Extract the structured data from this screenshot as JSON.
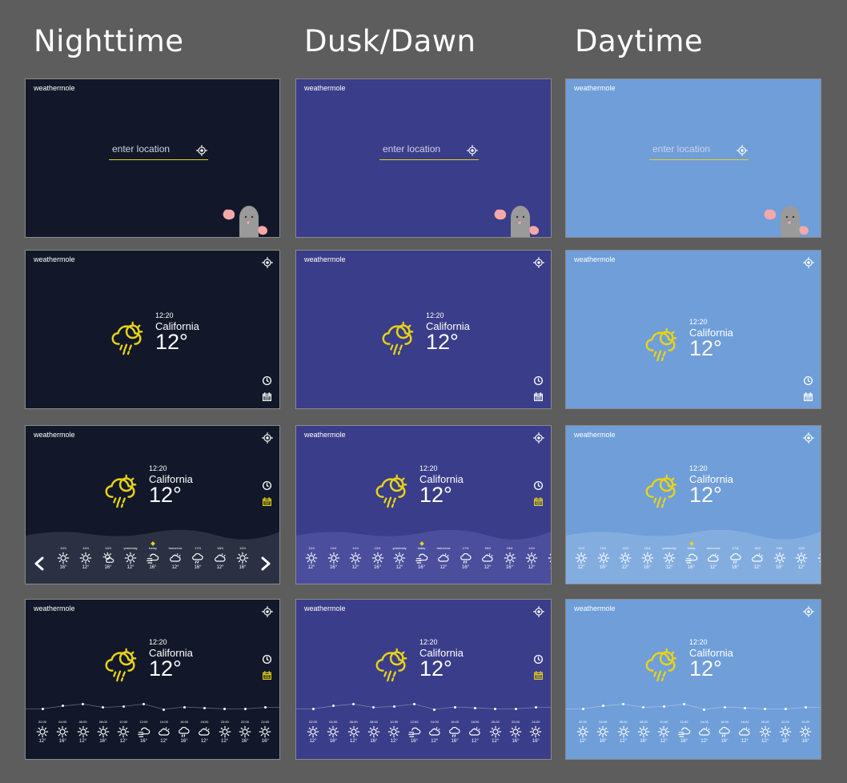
{
  "columns": [
    {
      "heading": "Nighttime",
      "theme": "night"
    },
    {
      "heading": "Dusk/Dawn",
      "theme": "dusk"
    },
    {
      "heading": "Daytime",
      "theme": "day"
    }
  ],
  "colors": {
    "background": "#5d5d5d",
    "night": "#121829",
    "dusk": "#3a3d89",
    "day": "#6f9ed9",
    "accent": "#e8d317",
    "night_hills": "#2b3143",
    "dusk_hills": "#4a4e9c",
    "day_hills": "#84addf",
    "mole_body": "#9a9a9a",
    "mole_paw": "#f4a9a8"
  },
  "app": {
    "brand": "weathermole",
    "search_placeholder": "enter location",
    "time": "12:20",
    "place": "California",
    "temperature": "12°"
  },
  "icons": {
    "location": "gps-target-icon",
    "pin": "location-pin-icon",
    "clock": "clock-icon",
    "calendar": "calendar-icon",
    "current_weather": "cloud-sun-rain-icon",
    "prev": "chevron-left-icon",
    "next": "chevron-right-icon"
  },
  "daily_forecast": [
    {
      "label": "12/4",
      "icon": "sun-icon",
      "temp": "16°"
    },
    {
      "label": "12/4",
      "icon": "sun-icon",
      "temp": "12°"
    },
    {
      "label": "12/4",
      "icon": "sun-cloud-icon",
      "temp": "16°"
    },
    {
      "label": "yesterday",
      "icon": "sun-icon",
      "temp": "12°"
    },
    {
      "label": "today",
      "icon": "wind-cloud-icon",
      "temp": "16°"
    },
    {
      "label": "tomorrow",
      "icon": "cloud-sun-icon",
      "temp": "12°"
    },
    {
      "label": "17/4",
      "icon": "cloud-rain-icon",
      "temp": "16°"
    },
    {
      "label": "18/4",
      "icon": "cloud-sun-icon",
      "temp": "12°"
    },
    {
      "label": "12/4",
      "icon": "sun-icon",
      "temp": "16°"
    }
  ],
  "daily_forecast_12": [
    {
      "label": "12/4",
      "icon": "sun-icon",
      "temp": "12°"
    },
    {
      "label": "12/4",
      "icon": "sun-icon",
      "temp": "16°"
    },
    {
      "label": "12/4",
      "icon": "sun-icon",
      "temp": "12°"
    },
    {
      "label": "12/4",
      "icon": "sun-icon",
      "temp": "16°"
    },
    {
      "label": "yesterday",
      "icon": "sun-icon",
      "temp": "12°"
    },
    {
      "label": "today",
      "icon": "wind-cloud-icon",
      "temp": "16°"
    },
    {
      "label": "tomorrow",
      "icon": "cloud-sun-icon",
      "temp": "12°"
    },
    {
      "label": "17/4",
      "icon": "cloud-rain-icon",
      "temp": "16°"
    },
    {
      "label": "18/4",
      "icon": "cloud-sun-icon",
      "temp": "12°"
    },
    {
      "label": "19/4",
      "icon": "sun-icon",
      "temp": "16°"
    },
    {
      "label": "12/4",
      "icon": "sun-icon",
      "temp": "12°"
    },
    {
      "label": "12/4",
      "icon": "sun-icon",
      "temp": "16°"
    }
  ],
  "hourly_forecast": [
    {
      "label": "02:00",
      "icon": "sun-icon",
      "temp": "12°",
      "level": 0.3
    },
    {
      "label": "04:00",
      "icon": "sun-icon",
      "temp": "16°",
      "level": 0.6
    },
    {
      "label": "06:00",
      "icon": "sun-icon",
      "temp": "12°",
      "level": 0.8
    },
    {
      "label": "08:00",
      "icon": "sun-icon",
      "temp": "16°",
      "level": 0.45
    },
    {
      "label": "10:00",
      "icon": "sun-icon",
      "temp": "12°",
      "level": 0.55
    },
    {
      "label": "12:00",
      "icon": "wind-cloud-icon",
      "temp": "16°",
      "level": 0.8
    },
    {
      "label": "14:00",
      "icon": "cloud-sun-icon",
      "temp": "12°",
      "level": 0.25
    },
    {
      "label": "16:00",
      "icon": "cloud-rain-icon",
      "temp": "16°",
      "level": 0.5
    },
    {
      "label": "18:00",
      "icon": "cloud-sun-icon",
      "temp": "12°",
      "level": 0.4
    },
    {
      "label": "20:00",
      "icon": "sun-icon",
      "temp": "12°",
      "level": 0.3
    },
    {
      "label": "22:00",
      "icon": "sun-icon",
      "temp": "16°",
      "level": 0.3
    },
    {
      "label": "24:00",
      "icon": "sun-icon",
      "temp": "16°",
      "level": 0.45
    }
  ]
}
